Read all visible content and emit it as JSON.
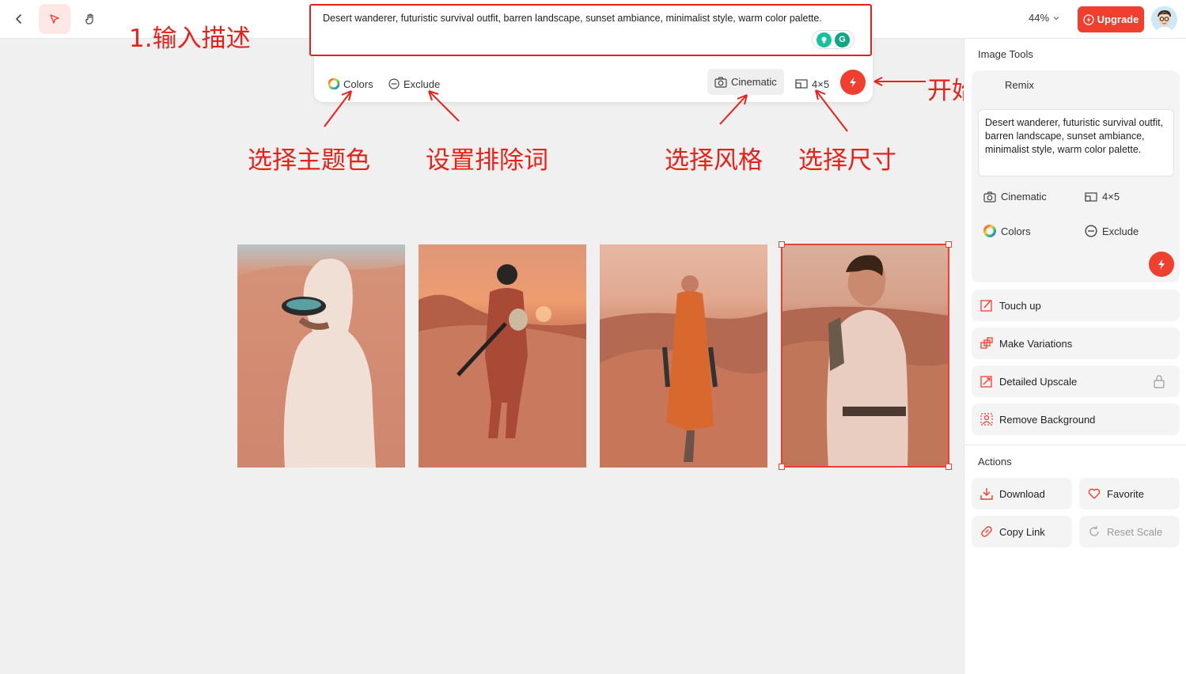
{
  "toolbar": {
    "zoom": "44%",
    "upgrade_label": "Upgrade"
  },
  "prompt": {
    "text": "Desert wanderer, futuristic survival outfit, barren landscape, sunset ambiance, minimalist style, warm color palette.",
    "colors_label": "Colors",
    "exclude_label": "Exclude",
    "style_label": "Cinematic",
    "size_label": "4×5"
  },
  "annotations": {
    "input": "1.输入描述",
    "colors": "选择主题色",
    "exclude": "设置排除词",
    "style": "选择风格",
    "size": "选择尺寸",
    "generate": "开始生成"
  },
  "sidebar": {
    "image_tools_title": "Image Tools",
    "remix_label": "Remix",
    "remix_text": "Desert wanderer, futuristic survival outfit, barren landscape, sunset ambiance, minimalist style, warm color palette.",
    "remix_style": "Cinematic",
    "remix_size": "4×5",
    "remix_colors": "Colors",
    "remix_exclude": "Exclude",
    "tools": [
      "Touch up",
      "Make Variations",
      "Detailed Upscale",
      "Remove Background"
    ],
    "actions_title": "Actions",
    "actions": [
      "Download",
      "Favorite",
      "Copy Link",
      "Reset Scale"
    ]
  },
  "colors": {
    "accent": "#f03e2f",
    "annotation": "#e8201a"
  }
}
